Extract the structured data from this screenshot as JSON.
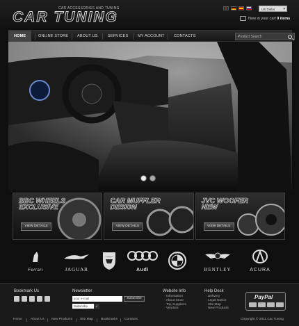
{
  "header": {
    "logo_text": "CAR TUNING",
    "tagline": "CAR ACCESSORIES AND TUNING",
    "currency": "US Dollar",
    "cart_prefix": "Now in your cart",
    "cart_count": "0 items"
  },
  "nav": {
    "items": [
      "HOME",
      "ONLINE STORE",
      "ABOUT US",
      "SERVICES",
      "MY ACCOUNT",
      "CONTACTS"
    ],
    "search_placeholder": "Product Search"
  },
  "slider": {
    "active_index": 0,
    "count": 2
  },
  "promos": [
    {
      "title": "BBC WHEELS EXCLUSIVE",
      "button": "VIEW DETAILS"
    },
    {
      "title": "CAR MUFFLER DESIGN",
      "button": "VIEW DETAILS"
    },
    {
      "title": "JVC WOOFER NEW",
      "button": "VIEW DETAILS"
    }
  ],
  "brands": [
    "Ferrari",
    "JAGUAR",
    "Lamborghini",
    "Audi",
    "BMW",
    "BENTLEY",
    "ACURA"
  ],
  "footer": {
    "bookmark_heading": "Bookmark Us",
    "newsletter_heading": "Newsletter",
    "email_placeholder": "your e-mail",
    "subscribe_button": "Subscribe",
    "subscribe_select": "Subscribe",
    "website_info_heading": "Website Info",
    "website_info_items": [
      "Information",
      "About Store",
      "Top Suppliers",
      "Vendors"
    ],
    "help_desk_heading": "Help Desk",
    "help_desk_items": [
      "Delivery",
      "Legal Notice",
      "Site Map",
      "New Products"
    ],
    "paypal_label": "PayPal"
  },
  "bottom_links": [
    "Home",
    "About Us",
    "New Products",
    "Site Map",
    "Bookmarks",
    "Contacts"
  ],
  "copyright": "Copyright © 2011 Car Tuning"
}
